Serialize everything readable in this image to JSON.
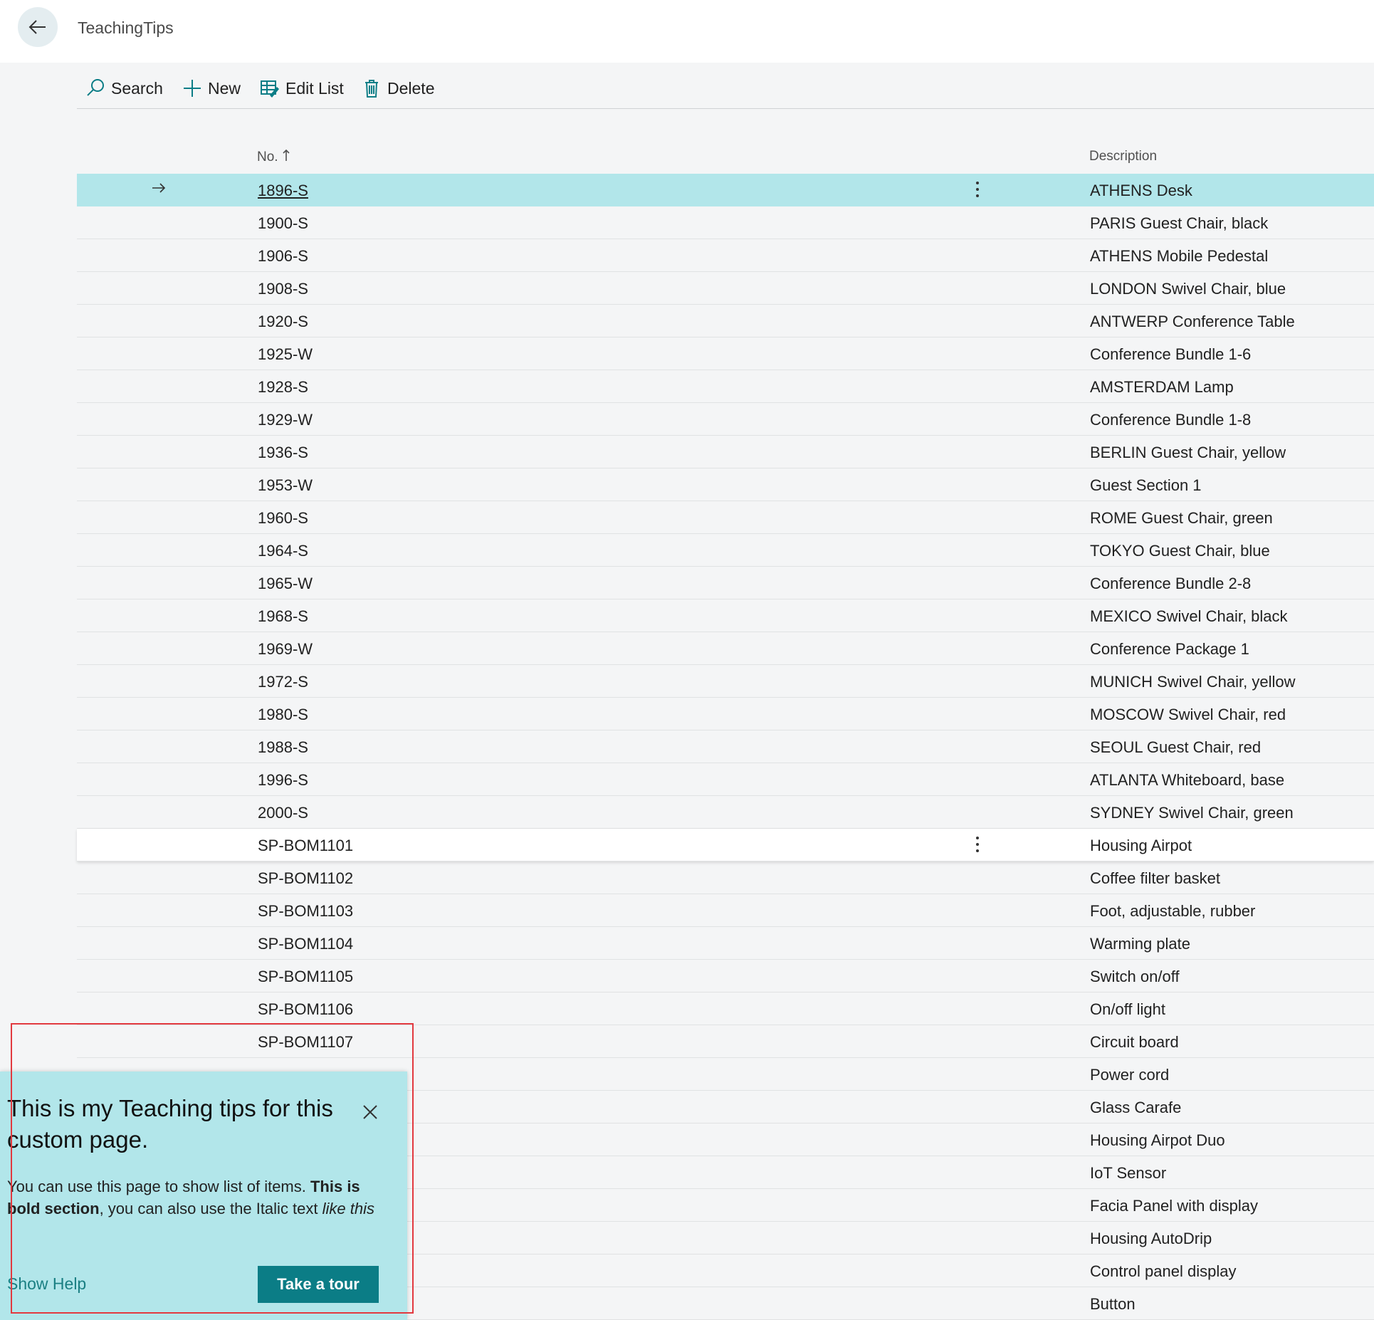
{
  "header": {
    "title": "TeachingTips"
  },
  "actions": {
    "search": "Search",
    "new": "New",
    "edit_list": "Edit List",
    "delete": "Delete"
  },
  "columns": {
    "no": "No.",
    "description": "Description"
  },
  "rows": [
    {
      "no": "1896-S",
      "desc": "ATHENS Desk"
    },
    {
      "no": "1900-S",
      "desc": "PARIS Guest Chair, black"
    },
    {
      "no": "1906-S",
      "desc": "ATHENS Mobile Pedestal"
    },
    {
      "no": "1908-S",
      "desc": "LONDON Swivel Chair, blue"
    },
    {
      "no": "1920-S",
      "desc": "ANTWERP Conference Table"
    },
    {
      "no": "1925-W",
      "desc": "Conference Bundle 1-6"
    },
    {
      "no": "1928-S",
      "desc": "AMSTERDAM Lamp"
    },
    {
      "no": "1929-W",
      "desc": "Conference Bundle 1-8"
    },
    {
      "no": "1936-S",
      "desc": "BERLIN Guest Chair, yellow"
    },
    {
      "no": "1953-W",
      "desc": "Guest Section 1"
    },
    {
      "no": "1960-S",
      "desc": "ROME Guest Chair, green"
    },
    {
      "no": "1964-S",
      "desc": "TOKYO Guest Chair, blue"
    },
    {
      "no": "1965-W",
      "desc": "Conference Bundle 2-8"
    },
    {
      "no": "1968-S",
      "desc": "MEXICO Swivel Chair, black"
    },
    {
      "no": "1969-W",
      "desc": "Conference Package 1"
    },
    {
      "no": "1972-S",
      "desc": "MUNICH Swivel Chair, yellow"
    },
    {
      "no": "1980-S",
      "desc": "MOSCOW Swivel Chair, red"
    },
    {
      "no": "1988-S",
      "desc": "SEOUL Guest Chair, red"
    },
    {
      "no": "1996-S",
      "desc": "ATLANTA Whiteboard, base"
    },
    {
      "no": "2000-S",
      "desc": "SYDNEY Swivel Chair, green"
    },
    {
      "no": "SP-BOM1101",
      "desc": "Housing Airpot"
    },
    {
      "no": "SP-BOM1102",
      "desc": "Coffee filter basket"
    },
    {
      "no": "SP-BOM1103",
      "desc": "Foot, adjustable, rubber"
    },
    {
      "no": "SP-BOM1104",
      "desc": "Warming plate"
    },
    {
      "no": "SP-BOM1105",
      "desc": "Switch on/off"
    },
    {
      "no": "SP-BOM1106",
      "desc": "On/off light"
    },
    {
      "no": "SP-BOM1107",
      "desc": "Circuit board"
    },
    {
      "no": "",
      "desc": "Power cord"
    },
    {
      "no": "",
      "desc": "Glass Carafe"
    },
    {
      "no": "",
      "desc": "Housing Airpot Duo"
    },
    {
      "no": "",
      "desc": "IoT Sensor"
    },
    {
      "no": "",
      "desc": "Facia Panel with display"
    },
    {
      "no": "",
      "desc": "Housing AutoDrip"
    },
    {
      "no": "",
      "desc": "Control panel display"
    },
    {
      "no": "",
      "desc": "Button"
    }
  ],
  "teaching_tip": {
    "title": "This is my Teaching tips for this custom page.",
    "body_1": "You can use this page to show list of items. ",
    "body_bold": "This is bold section",
    "body_2": ", you can also use the Italic text ",
    "body_italic": "like this",
    "help_link": "Show Help",
    "tour_button": "Take a tour"
  },
  "colors": {
    "accent": "#0b7d86",
    "selected_row": "#b2e6ea",
    "highlight_border": "#e2393f"
  }
}
